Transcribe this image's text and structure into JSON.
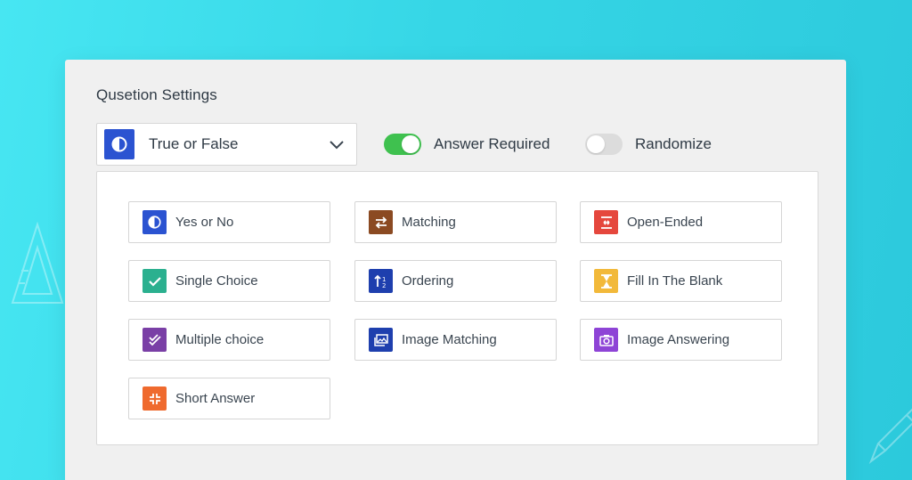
{
  "panel": {
    "title": "Qusetion Settings"
  },
  "type_select": {
    "selected_label": "True or False",
    "icon": "half-circle-icon",
    "icon_color": "#2b53d1"
  },
  "toggles": {
    "answer_required": {
      "label": "Answer Required",
      "on": true,
      "color": "#3fc14f"
    },
    "randomize": {
      "label": "Randomize",
      "on": false,
      "color": "#dcdcdc"
    }
  },
  "question_types": [
    {
      "label": "Yes or No",
      "icon": "half-circle-icon",
      "color": "#2b53d1"
    },
    {
      "label": "Matching",
      "icon": "swap-arrows-icon",
      "color": "#8b4a22"
    },
    {
      "label": "Open-Ended",
      "icon": "expand-text-icon",
      "color": "#e5473d"
    },
    {
      "label": "Single Choice",
      "icon": "check-icon",
      "color": "#2bb08f"
    },
    {
      "label": "Ordering",
      "icon": "sort-icon",
      "color": "#1e3fae"
    },
    {
      "label": "Fill In The Blank",
      "icon": "hourglass-icon",
      "color": "#f2b93a"
    },
    {
      "label": "Multiple choice",
      "icon": "double-check-icon",
      "color": "#7a3fa6"
    },
    {
      "label": "Image Matching",
      "icon": "image-icon",
      "color": "#1e3fae"
    },
    {
      "label": "Image Answering",
      "icon": "camera-icon",
      "color": "#8e44d6"
    },
    {
      "label": "Short Answer",
      "icon": "compress-icon",
      "color": "#ef6a2e"
    }
  ]
}
